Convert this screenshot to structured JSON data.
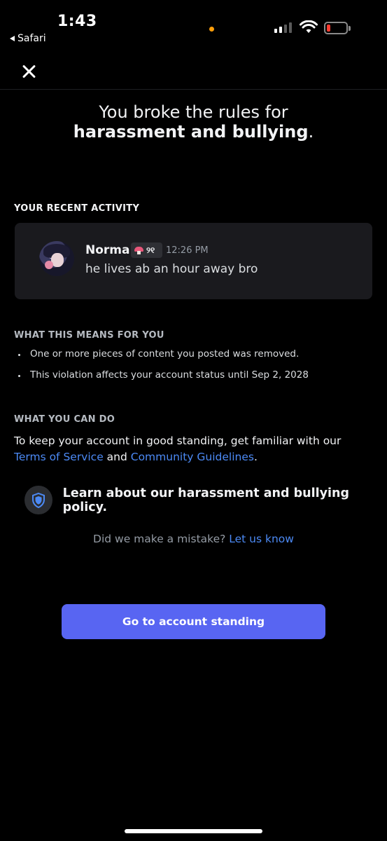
{
  "status_bar": {
    "time": "1:43",
    "back_app": "Safari",
    "signal_bars": 2,
    "battery_level": 0.1,
    "colors": {
      "battery_low": "#ff3b30",
      "recording_dot": "#ff9f0a"
    }
  },
  "header": {
    "close_icon": "close-icon"
  },
  "title": {
    "prefix": "You broke the rules for",
    "emphasis": "harassment and bullying",
    "suffix": "."
  },
  "recent_activity": {
    "label": "YOUR RECENT ACTIVITY",
    "message": {
      "username": "Norma",
      "badge_tag": "୨୧",
      "badge_icon": "mushroom-icon",
      "timestamp": "12:26 PM",
      "content": "he lives ab an hour away bro"
    }
  },
  "means": {
    "label": "WHAT THIS MEANS FOR YOU",
    "items": [
      "One or more pieces of content you posted was removed.",
      "This violation affects your account status until Sep 2, 2028"
    ]
  },
  "can_do": {
    "label": "WHAT YOU CAN DO",
    "text_before": "To keep your account in good standing, get familiar with our ",
    "link_tos": "Terms of Service",
    "text_and": " and ",
    "link_guidelines": "Community Guidelines",
    "text_end": "."
  },
  "policy": {
    "icon": "shield-icon",
    "label": "Learn about our harassment and bullying policy."
  },
  "mistake": {
    "text": "Did we make a mistake? ",
    "link": "Let us know"
  },
  "cta": {
    "label": "Go to account standing"
  },
  "colors": {
    "accent": "#5865f2",
    "link": "#4c8af5",
    "background": "#000000",
    "card": "#1a1a1e"
  }
}
